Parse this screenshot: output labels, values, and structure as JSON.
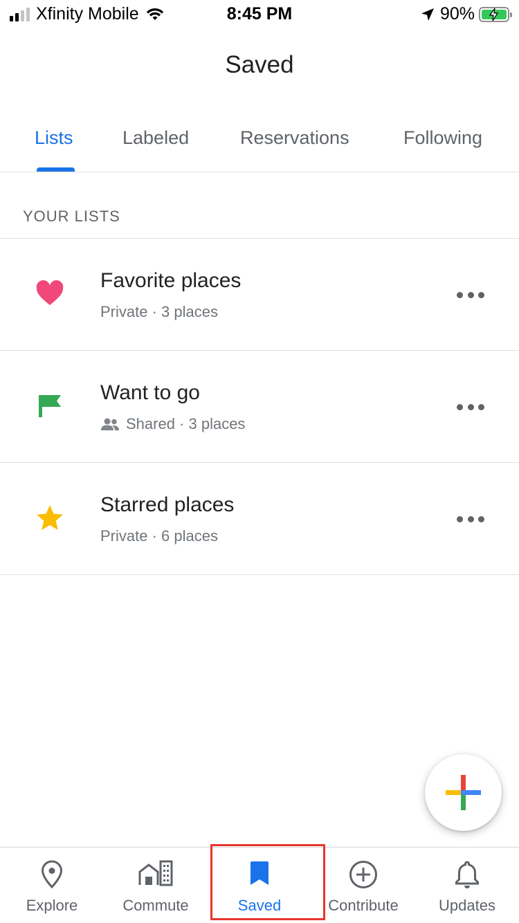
{
  "status_bar": {
    "carrier": "Xfinity Mobile",
    "time": "8:45 PM",
    "battery": "90%",
    "icons": [
      "signal-icon",
      "wifi-icon",
      "location-arrow-icon",
      "battery-charging-icon"
    ]
  },
  "header": {
    "title": "Saved"
  },
  "tabs": [
    {
      "label": "Lists",
      "active": true
    },
    {
      "label": "Labeled",
      "active": false
    },
    {
      "label": "Reservations",
      "active": false
    },
    {
      "label": "Following",
      "active": false
    }
  ],
  "section": {
    "title": "YOUR LISTS"
  },
  "lists": [
    {
      "title": "Favorite places",
      "subtitle": "Private · 3 places",
      "icon": "heart-icon",
      "color": "#f0487a"
    },
    {
      "title": "Want to go",
      "subtitle": "Shared · 3 places",
      "icon": "flag-icon",
      "color": "#34a853",
      "shared_icon": "people-icon"
    },
    {
      "title": "Starred places",
      "subtitle": "Private · 6 places",
      "icon": "star-icon",
      "color": "#fbbc04"
    }
  ],
  "fab": {
    "icon": "plus-icon",
    "colors": [
      "#ea4335",
      "#4285f4",
      "#fbbc04",
      "#34a853"
    ]
  },
  "bottom_nav": [
    {
      "label": "Explore",
      "icon": "map-pin-icon",
      "active": false
    },
    {
      "label": "Commute",
      "icon": "commute-icon",
      "active": false
    },
    {
      "label": "Saved",
      "icon": "bookmark-icon",
      "active": true
    },
    {
      "label": "Contribute",
      "icon": "add-circle-icon",
      "active": false
    },
    {
      "label": "Updates",
      "icon": "bell-icon",
      "active": false
    }
  ],
  "colors": {
    "accent": "#1a73e8",
    "highlight": "#e8352b"
  }
}
